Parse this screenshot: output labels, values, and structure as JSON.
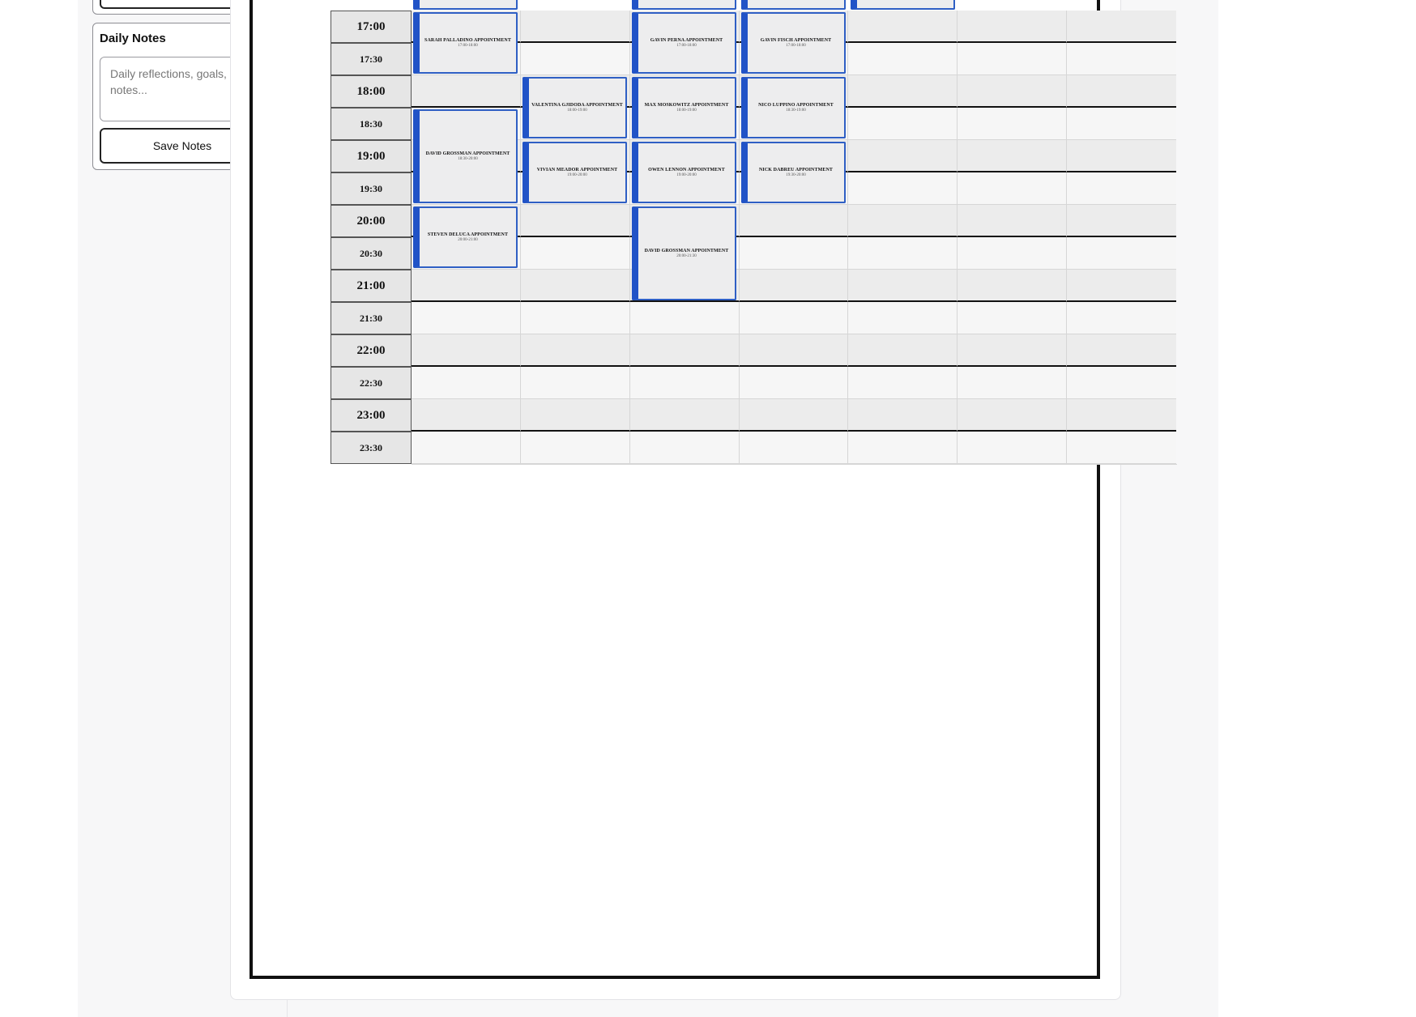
{
  "sidebar": {
    "notes": {
      "title": "Daily Notes",
      "placeholder": "Daily reflections, goals, and notes...",
      "value": "",
      "save_label": "Save Notes"
    }
  },
  "calendar": {
    "time_slots": [
      {
        "label": "17:00",
        "kind": "hour"
      },
      {
        "label": "17:30",
        "kind": "half"
      },
      {
        "label": "18:00",
        "kind": "hour"
      },
      {
        "label": "18:30",
        "kind": "half"
      },
      {
        "label": "19:00",
        "kind": "hour"
      },
      {
        "label": "19:30",
        "kind": "half"
      },
      {
        "label": "20:00",
        "kind": "hour"
      },
      {
        "label": "20:30",
        "kind": "half"
      },
      {
        "label": "21:00",
        "kind": "hour"
      },
      {
        "label": "21:30",
        "kind": "half"
      },
      {
        "label": "22:00",
        "kind": "hour"
      },
      {
        "label": "22:30",
        "kind": "half"
      },
      {
        "label": "23:00",
        "kind": "hour"
      },
      {
        "label": "23:30",
        "kind": "half"
      }
    ],
    "day_count": 7,
    "accent_color": "#2153c7",
    "events": [
      {
        "day": 0,
        "start": "17:00",
        "end": "18:00",
        "title": "SARAH PALLADINO APPOINTMENT",
        "time": "17:00-18:00"
      },
      {
        "day": 0,
        "start": "18:30",
        "end": "20:00",
        "title": "DAVID GROSSMAN APPOINTMENT",
        "time": "18:30-20:00"
      },
      {
        "day": 0,
        "start": "20:00",
        "end": "21:00",
        "title": "STEVEN DELUCA APPOINTMENT",
        "time": "20:00-21:00"
      },
      {
        "day": 1,
        "start": "18:00",
        "end": "19:00",
        "title": "VALENTINA GJIDODA APPOINTMENT",
        "time": "18:00-19:00"
      },
      {
        "day": 1,
        "start": "19:00",
        "end": "20:00",
        "title": "VIVIAN MEADOR APPOINTMENT",
        "time": "19:00-20:00"
      },
      {
        "day": 2,
        "start": "17:00",
        "end": "18:00",
        "title": "GAVIN PERNA APPOINTMENT",
        "time": "17:00-18:00"
      },
      {
        "day": 2,
        "start": "18:00",
        "end": "19:00",
        "title": "MAX MOSKOWITZ APPOINTMENT",
        "time": "18:00-19:00"
      },
      {
        "day": 2,
        "start": "19:00",
        "end": "20:00",
        "title": "OWEN LENNON APPOINTMENT",
        "time": "19:00-20:00"
      },
      {
        "day": 2,
        "start": "20:00",
        "end": "21:30",
        "title": "DAVID GROSSMAN APPOINTMENT",
        "time": "20:00-21:30"
      },
      {
        "day": 3,
        "start": "17:00",
        "end": "18:00",
        "title": "GAVIN FISCH APPOINTMENT",
        "time": "17:00-18:00"
      },
      {
        "day": 3,
        "start": "18:00",
        "end": "19:00",
        "title": "NICO LUPPINO APPOINTMENT",
        "time": "18:30-19:00"
      },
      {
        "day": 3,
        "start": "19:00",
        "end": "20:00",
        "title": "NICK DABREU APPOINTMENT",
        "time": "19:30-20:00"
      }
    ],
    "partial_events_above": [
      {
        "day": 0
      },
      {
        "day": 2
      },
      {
        "day": 3
      },
      {
        "day": 4
      }
    ]
  }
}
